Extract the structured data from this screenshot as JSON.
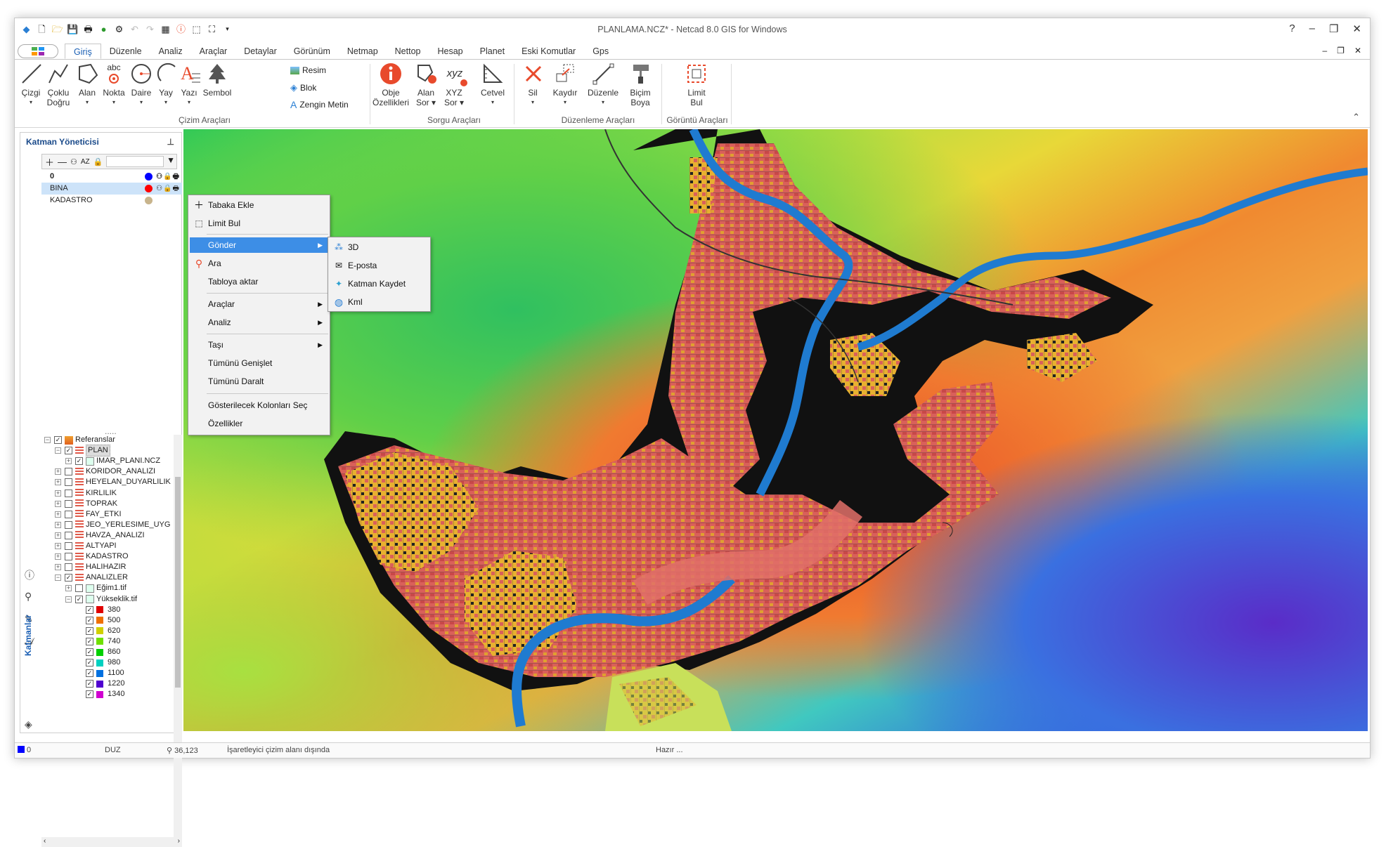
{
  "window": {
    "title": "PLANLAMA.NCZ* - Netcad 8.0 GIS for Windows",
    "help": "?",
    "min": "–",
    "restore": "❐",
    "close": "✕"
  },
  "mdi": {
    "min": "–",
    "restore": "❐",
    "close": "✕"
  },
  "tabs": [
    "Giriş",
    "Düzenle",
    "Analiz",
    "Araçlar",
    "Detaylar",
    "Görünüm",
    "Netmap",
    "Nettop",
    "Hesap",
    "Planet",
    "Eski Komutlar",
    "Gps"
  ],
  "ribbon": {
    "tools": [
      {
        "l1": "Çizgi",
        "l2": ""
      },
      {
        "l1": "Çoklu",
        "l2": "Doğru"
      },
      {
        "l1": "Alan",
        "l2": ""
      },
      {
        "l1": "Nokta",
        "l2": ""
      },
      {
        "l1": "Daire",
        "l2": ""
      },
      {
        "l1": "Yay",
        "l2": ""
      },
      {
        "l1": "Yazı",
        "l2": ""
      },
      {
        "l1": "Sembol",
        "l2": ""
      },
      {
        "l1": "Obje",
        "l2": "Özellikleri"
      },
      {
        "l1": "Alan",
        "l2": "Sor"
      },
      {
        "l1": "XYZ",
        "l2": "Sor"
      },
      {
        "l1": "Cetvel",
        "l2": ""
      },
      {
        "l1": "Sil",
        "l2": ""
      },
      {
        "l1": "Kaydır",
        "l2": ""
      },
      {
        "l1": "Düzenle",
        "l2": ""
      },
      {
        "l1": "Biçim",
        "l2": "Boya"
      },
      {
        "l1": "Limit",
        "l2": "Bul"
      }
    ],
    "small": [
      "Resim",
      "Blok",
      "Zengin Metin"
    ],
    "groups": [
      "Çizim Araçları",
      "Sorgu Araçları",
      "Düzenleme Araçları",
      "Görüntü Araçları"
    ],
    "nokta_abc": "abc",
    "xyz_text": "xyz"
  },
  "layer_panel": {
    "title": "Katman Yöneticisi",
    "layers": [
      {
        "name": "0",
        "color": "#0000ff"
      },
      {
        "name": "BINA",
        "color": "#ff0000"
      },
      {
        "name": "KADASTRO",
        "color": "#c8b48c"
      }
    ],
    "tree": [
      {
        "label": "Referanslar",
        "level": 0,
        "exp": "−",
        "checked": true
      },
      {
        "label": "PLAN",
        "level": 1,
        "exp": "−",
        "checked": true
      },
      {
        "label": "IMAR_PLANI.NCZ",
        "level": 2,
        "exp": "+",
        "checked": true
      },
      {
        "label": "KORIDOR_ANALIZI",
        "level": 1,
        "exp": "+",
        "checked": false
      },
      {
        "label": "HEYELAN_DUYARLILIK",
        "level": 1,
        "exp": "+",
        "checked": false
      },
      {
        "label": "KIRLILIK",
        "level": 1,
        "exp": "+",
        "checked": false
      },
      {
        "label": "TOPRAK",
        "level": 1,
        "exp": "+",
        "checked": false
      },
      {
        "label": "FAY_ETKI",
        "level": 1,
        "exp": "+",
        "checked": false
      },
      {
        "label": "JEO_YERLESIME_UYG",
        "level": 1,
        "exp": "+",
        "checked": false
      },
      {
        "label": "HAVZA_ANALIZI",
        "level": 1,
        "exp": "+",
        "checked": false
      },
      {
        "label": "ALTYAPI",
        "level": 1,
        "exp": "+",
        "checked": false
      },
      {
        "label": "KADASTRO",
        "level": 1,
        "exp": "+",
        "checked": false
      },
      {
        "label": "HALIHAZIR",
        "level": 1,
        "exp": "+",
        "checked": false
      },
      {
        "label": "ANALIZLER",
        "level": 1,
        "exp": "−",
        "checked": true
      },
      {
        "label": "Eğim1.tif",
        "level": 2,
        "exp": "+",
        "checked": false
      },
      {
        "label": "Yükseklik.tif",
        "level": 2,
        "exp": "−",
        "checked": true
      },
      {
        "label": "380",
        "level": 3,
        "color": "#e00000",
        "checked": true
      },
      {
        "label": "500",
        "level": 3,
        "color": "#f07000",
        "checked": true
      },
      {
        "label": "620",
        "level": 3,
        "color": "#d0d000",
        "checked": true
      },
      {
        "label": "740",
        "level": 3,
        "color": "#70e000",
        "checked": true
      },
      {
        "label": "860",
        "level": 3,
        "color": "#00d000",
        "checked": true
      },
      {
        "label": "980",
        "level": 3,
        "color": "#00d0c0",
        "checked": true
      },
      {
        "label": "1100",
        "level": 3,
        "color": "#0070e0",
        "checked": true
      },
      {
        "label": "1220",
        "level": 3,
        "color": "#5000d0",
        "checked": true
      },
      {
        "label": "1340",
        "level": 3,
        "color": "#d000d0",
        "checked": true
      }
    ],
    "vertical_tab": "Katmanlar"
  },
  "context_menu": {
    "items": [
      "Tabaka Ekle",
      "Limit Bul",
      "Gönder",
      "Ara",
      "Tabloya aktar",
      "Araçlar",
      "Analiz",
      "Taşı",
      "Tümünü Genişlet",
      "Tümünü Daralt",
      "Gösterilecek Kolonları Seç",
      "Özellikler"
    ]
  },
  "submenu": {
    "items": [
      "3D",
      "E-posta",
      "Katman Kaydet",
      "Kml"
    ]
  },
  "status": {
    "layer": "0",
    "mode": "DUZ",
    "coords": "36,123",
    "message": "İşaretleyici çizim alanı dışında",
    "ready": "Hazır ..."
  },
  "colors": {
    "accent": "#3d8ee6",
    "ribbon_red": "#e84a2c",
    "map_urban": "#d9605a"
  }
}
